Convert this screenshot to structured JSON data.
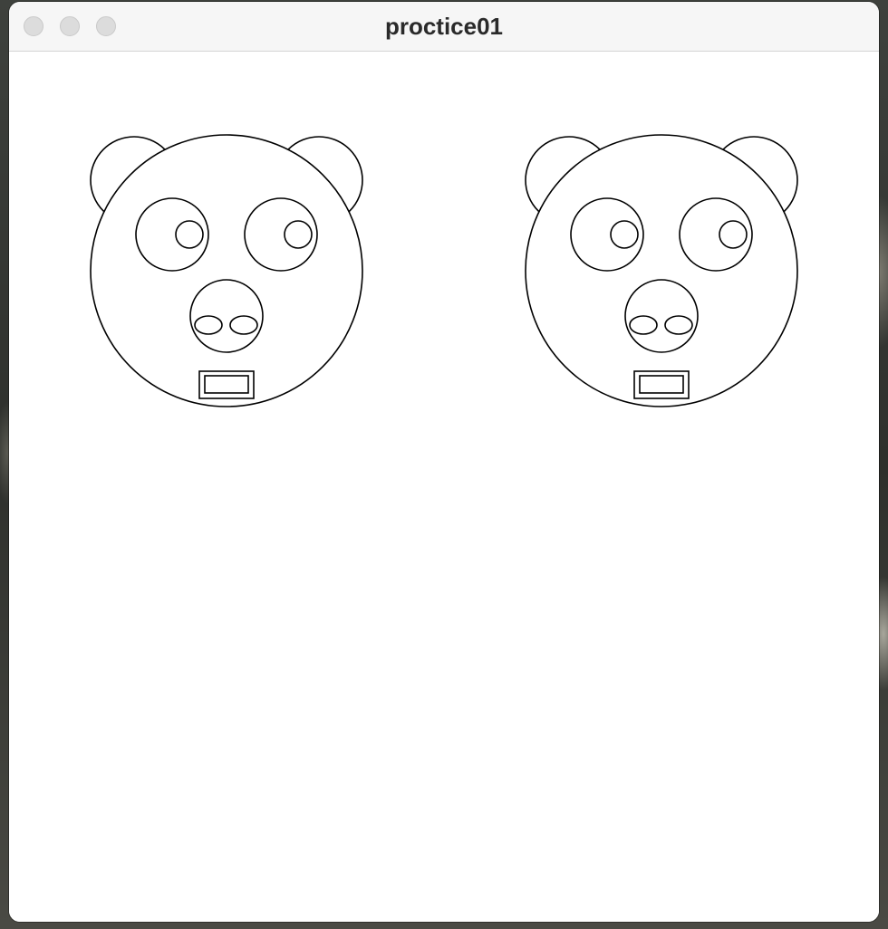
{
  "window": {
    "title": "proctice01",
    "traffic_lights": [
      "close-button",
      "minimize-button",
      "zoom-button"
    ]
  },
  "canvas": {
    "background": "#ffffff",
    "stroke": "#000000",
    "figures": [
      "bear-face",
      "bear-face"
    ]
  }
}
